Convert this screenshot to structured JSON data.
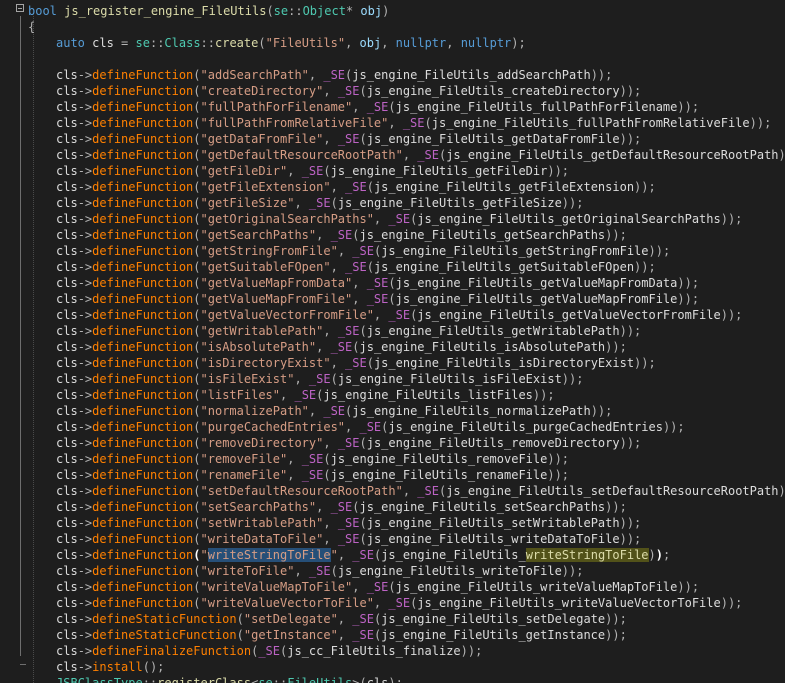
{
  "colors": {
    "background": "#1e1e1e",
    "keyword": "#569cd6",
    "function": "#dcdcaa",
    "member_function": "#ff8000",
    "type": "#4ec9b0",
    "string": "#d69d85",
    "identifier": "#dcdcdc",
    "parameter": "#9cdcfe",
    "macro": "#bd63c5",
    "selection": "#264f78",
    "match_highlight": "#525219"
  },
  "header": {
    "ret_type": "bool",
    "func_name": "js_register_engine_FileUtils",
    "ns": "se",
    "sep": "::",
    "obj_type": "Object",
    "ptr": "*",
    "param": "obj",
    "open_paren": "(",
    "close_paren": ")"
  },
  "open_brace": "{",
  "auto_line": {
    "auto_kw": "auto",
    "var": "cls",
    "eq": " = ",
    "ns": "se",
    "sep": "::",
    "cls_type": "Class",
    "create_fn": "create",
    "arg_str": "\"FileUtils\"",
    "obj": "obj",
    "null1": "nullptr",
    "null2": "nullptr",
    "end": ");"
  },
  "tokens": {
    "cls": "cls",
    "arrow": "->",
    "se_macro": "_SE",
    "comma": ", ",
    "end": "));",
    "open_paren": "(",
    "close_paren": ")"
  },
  "functions": [
    {
      "method": "defineFunction",
      "js_name": "\"addSearchPath\"",
      "binding": "js_engine_FileUtils_addSearchPath"
    },
    {
      "method": "defineFunction",
      "js_name": "\"createDirectory\"",
      "binding": "js_engine_FileUtils_createDirectory"
    },
    {
      "method": "defineFunction",
      "js_name": "\"fullPathForFilename\"",
      "binding": "js_engine_FileUtils_fullPathForFilename"
    },
    {
      "method": "defineFunction",
      "js_name": "\"fullPathFromRelativeFile\"",
      "binding": "js_engine_FileUtils_fullPathFromRelativeFile"
    },
    {
      "method": "defineFunction",
      "js_name": "\"getDataFromFile\"",
      "binding": "js_engine_FileUtils_getDataFromFile"
    },
    {
      "method": "defineFunction",
      "js_name": "\"getDefaultResourceRootPath\"",
      "binding": "js_engine_FileUtils_getDefaultResourceRootPath"
    },
    {
      "method": "defineFunction",
      "js_name": "\"getFileDir\"",
      "binding": "js_engine_FileUtils_getFileDir"
    },
    {
      "method": "defineFunction",
      "js_name": "\"getFileExtension\"",
      "binding": "js_engine_FileUtils_getFileExtension"
    },
    {
      "method": "defineFunction",
      "js_name": "\"getFileSize\"",
      "binding": "js_engine_FileUtils_getFileSize"
    },
    {
      "method": "defineFunction",
      "js_name": "\"getOriginalSearchPaths\"",
      "binding": "js_engine_FileUtils_getOriginalSearchPaths"
    },
    {
      "method": "defineFunction",
      "js_name": "\"getSearchPaths\"",
      "binding": "js_engine_FileUtils_getSearchPaths"
    },
    {
      "method": "defineFunction",
      "js_name": "\"getStringFromFile\"",
      "binding": "js_engine_FileUtils_getStringFromFile"
    },
    {
      "method": "defineFunction",
      "js_name": "\"getSuitableFOpen\"",
      "binding": "js_engine_FileUtils_getSuitableFOpen"
    },
    {
      "method": "defineFunction",
      "js_name": "\"getValueMapFromData\"",
      "binding": "js_engine_FileUtils_getValueMapFromData"
    },
    {
      "method": "defineFunction",
      "js_name": "\"getValueMapFromFile\"",
      "binding": "js_engine_FileUtils_getValueMapFromFile"
    },
    {
      "method": "defineFunction",
      "js_name": "\"getValueVectorFromFile\"",
      "binding": "js_engine_FileUtils_getValueVectorFromFile"
    },
    {
      "method": "defineFunction",
      "js_name": "\"getWritablePath\"",
      "binding": "js_engine_FileUtils_getWritablePath"
    },
    {
      "method": "defineFunction",
      "js_name": "\"isAbsolutePath\"",
      "binding": "js_engine_FileUtils_isAbsolutePath"
    },
    {
      "method": "defineFunction",
      "js_name": "\"isDirectoryExist\"",
      "binding": "js_engine_FileUtils_isDirectoryExist"
    },
    {
      "method": "defineFunction",
      "js_name": "\"isFileExist\"",
      "binding": "js_engine_FileUtils_isFileExist"
    },
    {
      "method": "defineFunction",
      "js_name": "\"listFiles\"",
      "binding": "js_engine_FileUtils_listFiles"
    },
    {
      "method": "defineFunction",
      "js_name": "\"normalizePath\"",
      "binding": "js_engine_FileUtils_normalizePath"
    },
    {
      "method": "defineFunction",
      "js_name": "\"purgeCachedEntries\"",
      "binding": "js_engine_FileUtils_purgeCachedEntries"
    },
    {
      "method": "defineFunction",
      "js_name": "\"removeDirectory\"",
      "binding": "js_engine_FileUtils_removeDirectory"
    },
    {
      "method": "defineFunction",
      "js_name": "\"removeFile\"",
      "binding": "js_engine_FileUtils_removeFile"
    },
    {
      "method": "defineFunction",
      "js_name": "\"renameFile\"",
      "binding": "js_engine_FileUtils_renameFile"
    },
    {
      "method": "defineFunction",
      "js_name": "\"setDefaultResourceRootPath\"",
      "binding": "js_engine_FileUtils_setDefaultResourceRootPath"
    },
    {
      "method": "defineFunction",
      "js_name": "\"setSearchPaths\"",
      "binding": "js_engine_FileUtils_setSearchPaths"
    },
    {
      "method": "defineFunction",
      "js_name": "\"setWritablePath\"",
      "binding": "js_engine_FileUtils_setWritablePath"
    },
    {
      "method": "defineFunction",
      "js_name": "\"writeDataToFile\"",
      "binding": "js_engine_FileUtils_writeDataToFile"
    }
  ],
  "selected_line": {
    "method": "defineFunction",
    "quote": "\"",
    "js_name_selected": "writeStringToFile",
    "binding_prefix": "js_engine_FileUtils_",
    "binding_highlight": "writeStringToFile"
  },
  "functions_after": [
    {
      "method": "defineFunction",
      "js_name": "\"writeToFile\"",
      "binding": "js_engine_FileUtils_writeToFile"
    },
    {
      "method": "defineFunction",
      "js_name": "\"writeValueMapToFile\"",
      "binding": "js_engine_FileUtils_writeValueMapToFile"
    },
    {
      "method": "defineFunction",
      "js_name": "\"writeValueVectorToFile\"",
      "binding": "js_engine_FileUtils_writeValueVectorToFile"
    },
    {
      "method": "defineStaticFunction",
      "js_name": "\"setDelegate\"",
      "binding": "js_engine_FileUtils_setDelegate"
    },
    {
      "method": "defineStaticFunction",
      "js_name": "\"getInstance\"",
      "binding": "js_engine_FileUtils_getInstance"
    }
  ],
  "finalize_line": {
    "method": "defineFinalizeFunction",
    "binding": "js_cc_FileUtils_finalize",
    "end": "));"
  },
  "install_line": {
    "method": "install",
    "end": "();"
  },
  "last_line": {
    "type": "JSBClassType",
    "sep": "::",
    "fn": "registerClass",
    "ns": "se",
    "cls": "FileUtils",
    "cls_arg": "cls",
    "open": "<",
    "close": ">",
    "open_paren": "(",
    "end": ");"
  }
}
